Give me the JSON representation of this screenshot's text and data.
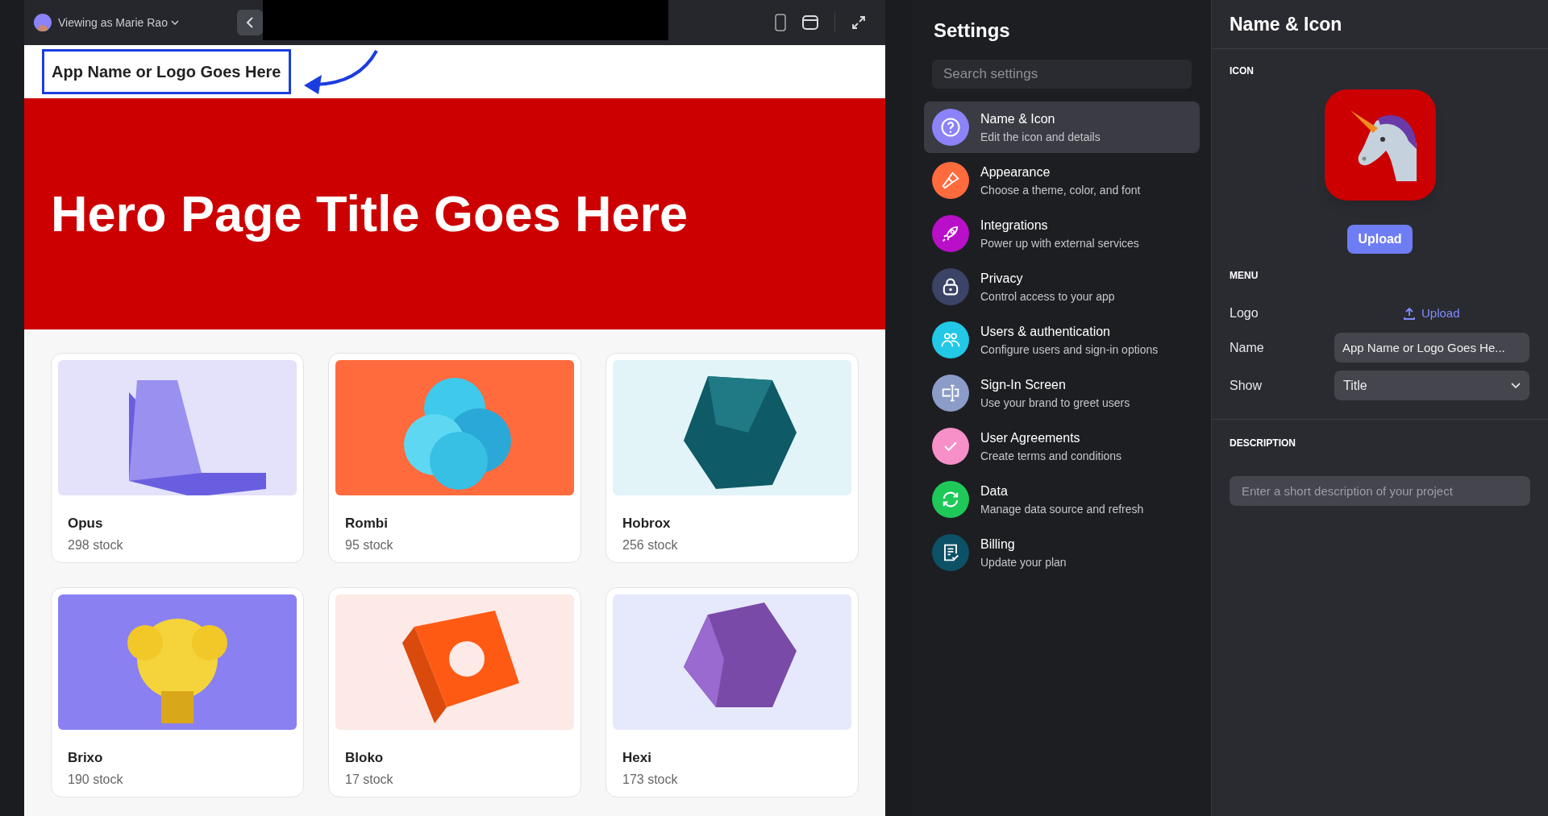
{
  "preview": {
    "viewer": "Viewing as Marie Rao",
    "header_title": "App Name or Logo Goes Here",
    "hero_title": "Hero Page Title Goes Here",
    "products": [
      {
        "name": "Opus",
        "stock": "298 stock"
      },
      {
        "name": "Rombi",
        "stock": "95 stock"
      },
      {
        "name": "Hobrox",
        "stock": "256 stock"
      },
      {
        "name": "Brixo",
        "stock": "190 stock"
      },
      {
        "name": "Bloko",
        "stock": "17 stock"
      },
      {
        "name": "Hexi",
        "stock": "173 stock"
      }
    ]
  },
  "settings": {
    "title": "Settings",
    "search": {
      "placeholder": "Search settings"
    },
    "items": [
      {
        "label": "Name & Icon",
        "description": "Edit the icon and details",
        "color": "#8b83f7",
        "selected": true
      },
      {
        "label": "Appearance",
        "description": "Choose a theme, color, and font",
        "color": "#ff6b3d",
        "selected": false
      },
      {
        "label": "Integrations",
        "description": "Power up with external services",
        "color": "#b90fc8",
        "selected": false
      },
      {
        "label": "Privacy",
        "description": "Control access to your app",
        "color": "#3b4466",
        "selected": false
      },
      {
        "label": "Users & authentication",
        "description": "Configure users and sign-in options",
        "color": "#22c8e5",
        "selected": false
      },
      {
        "label": "Sign-In Screen",
        "description": "Use your brand to greet users",
        "color": "#8c9cc8",
        "selected": false
      },
      {
        "label": "User Agreements",
        "description": "Create terms and conditions",
        "color": "#f78fc8",
        "selected": false
      },
      {
        "label": "Data",
        "description": "Manage data source and refresh",
        "color": "#1ec95a",
        "selected": false
      },
      {
        "label": "Billing",
        "description": "Update your plan",
        "color": "#0d5166",
        "selected": false
      }
    ]
  },
  "detail": {
    "title": "Name & Icon",
    "icon_section": "ICON",
    "upload_button": "Upload",
    "menu_section": "MENU",
    "logo_label": "Logo",
    "logo_upload": "Upload",
    "name_label": "Name",
    "name_value": "App Name or Logo Goes He...",
    "show_label": "Show",
    "show_value": "Title",
    "description_section": "DESCRIPTION",
    "description": {
      "placeholder": "Enter a short description of your project"
    }
  }
}
